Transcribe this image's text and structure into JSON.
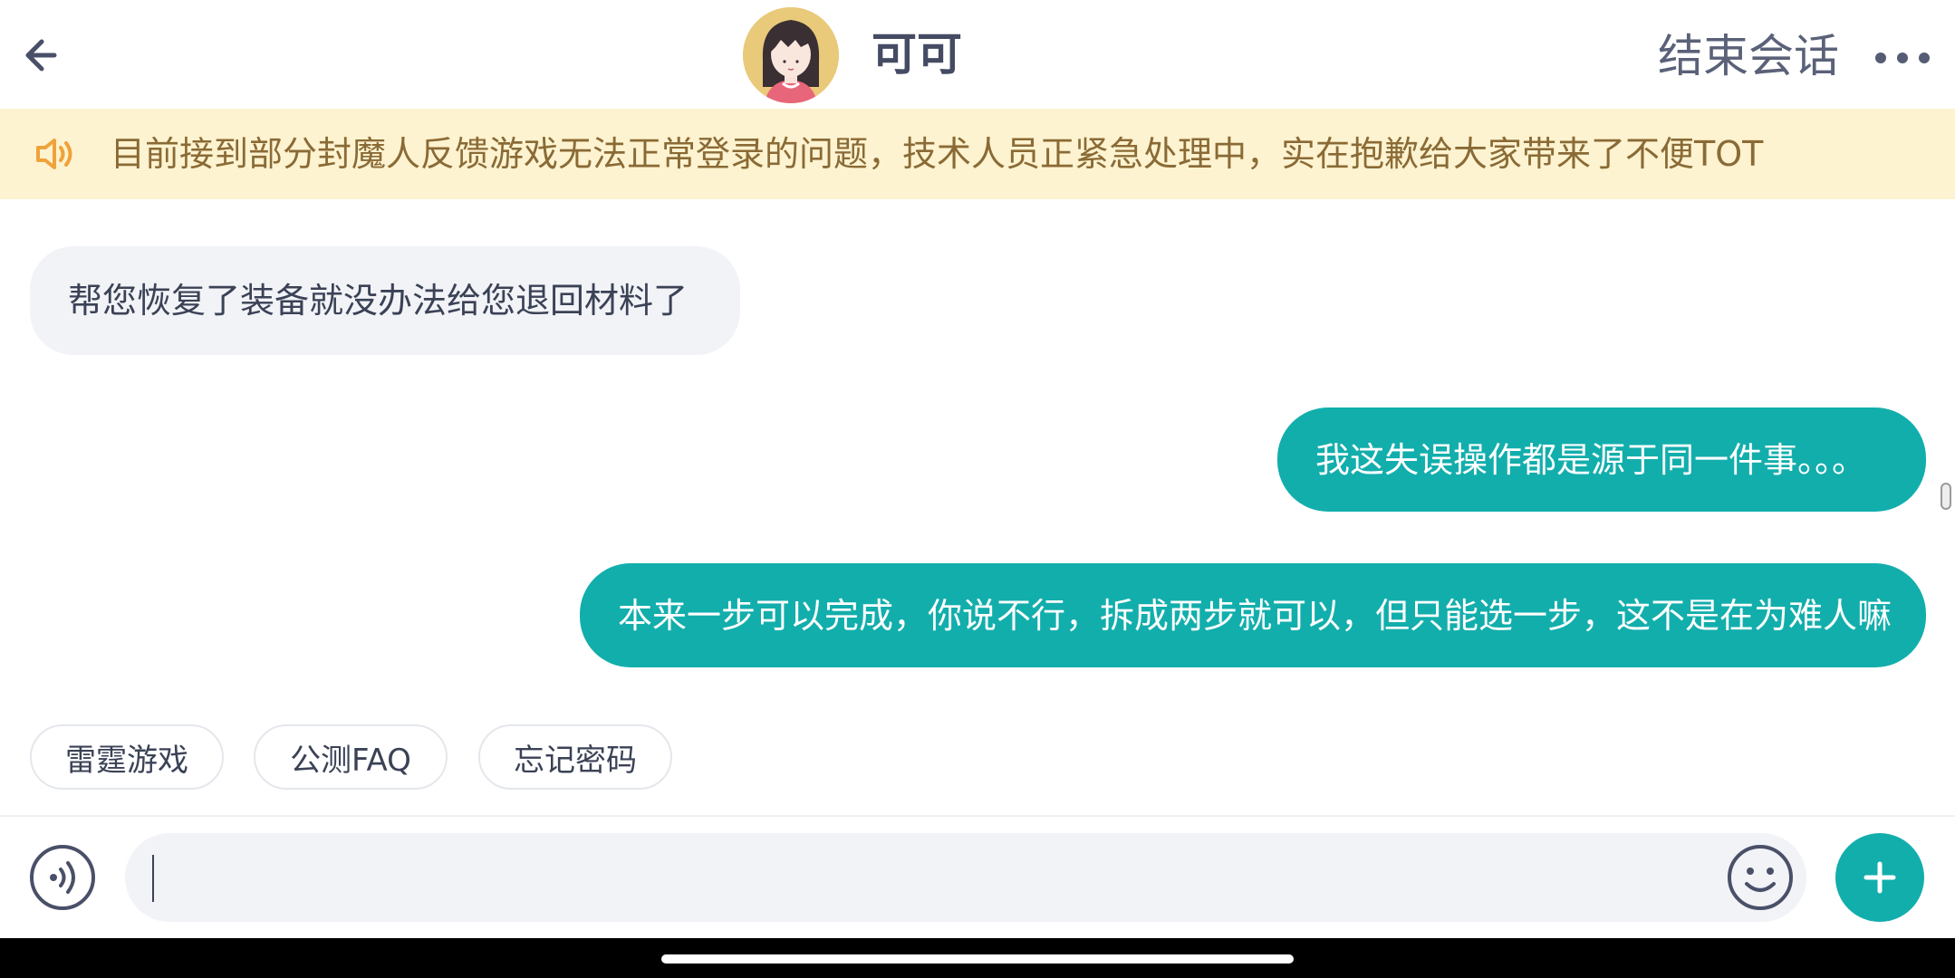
{
  "header": {
    "title": "可可",
    "end_session_label": "结束会话",
    "icons": {
      "back": "back-arrow-icon",
      "more": "more-dots-icon"
    }
  },
  "notice": {
    "text": "目前接到部分封魔人反馈游戏无法正常登录的问题，技术人员正紧急处理中，实在抱歉给大家带来了不便TOT",
    "icon": "speaker-icon"
  },
  "messages": [
    {
      "direction": "incoming",
      "text": "帮您恢复了装备就没办法给您退回材料了"
    },
    {
      "direction": "outgoing",
      "text": "我这失误操作都是源于同一件事。。。"
    },
    {
      "direction": "outgoing",
      "text": "本来一步可以完成，你说不行，拆成两步就可以，但只能选一步，这不是在为难人嘛"
    }
  ],
  "quick_replies": [
    {
      "label": "雷霆游戏"
    },
    {
      "label": "公测FAQ"
    },
    {
      "label": "忘记密码"
    }
  ],
  "composer": {
    "value": "",
    "placeholder": "",
    "icons": {
      "voice": "voice-icon",
      "emoji": "emoji-icon",
      "add": "plus-icon"
    }
  },
  "colors": {
    "accent": "#12aeac",
    "notice_bg": "#fdf3d0",
    "notice_text": "#8a6a35",
    "incoming_bubble": "#f1f3f7"
  }
}
